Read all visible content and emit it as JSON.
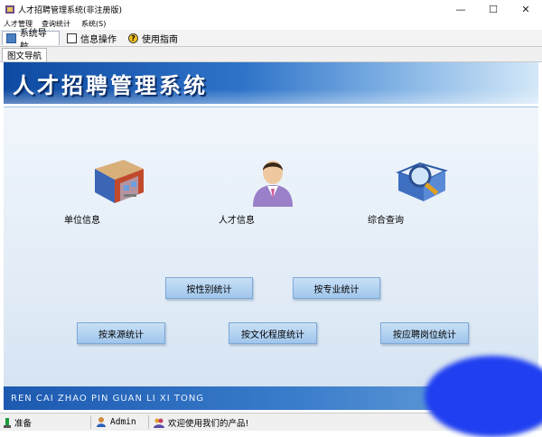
{
  "window": {
    "title": "人才招聘管理系统(非注册版)"
  },
  "menu": [
    "人才管理",
    "查询统计",
    "系统(S)"
  ],
  "tabs": [
    {
      "label": "系统导航",
      "icon": "navigation-icon"
    },
    {
      "label": "信息操作",
      "icon": "info-operation-icon"
    },
    {
      "label": "使用指南",
      "icon": "help-icon"
    }
  ],
  "subtab": "图文导航",
  "banner": {
    "title": "人才招聘管理系统"
  },
  "modules": [
    {
      "label": "单位信息",
      "icon": "company-building-icon"
    },
    {
      "label": "人才信息",
      "icon": "person-icon"
    },
    {
      "label": "综合查询",
      "icon": "search-magnifier-icon"
    }
  ],
  "stat_buttons": [
    "按性别统计",
    "按专业统计",
    "按来源统计",
    "按文化程度统计",
    "按应聘岗位统计"
  ],
  "footer_text": "REN CAI ZHAO PIN GUAN LI XI TONG",
  "status": {
    "ready": "准备",
    "user": "Admin",
    "welcome": "欢迎使用我们的产品!"
  },
  "colors": {
    "banner": "#1a56b0",
    "button": "#b3d3f2",
    "footer": "#2a6ac0"
  }
}
